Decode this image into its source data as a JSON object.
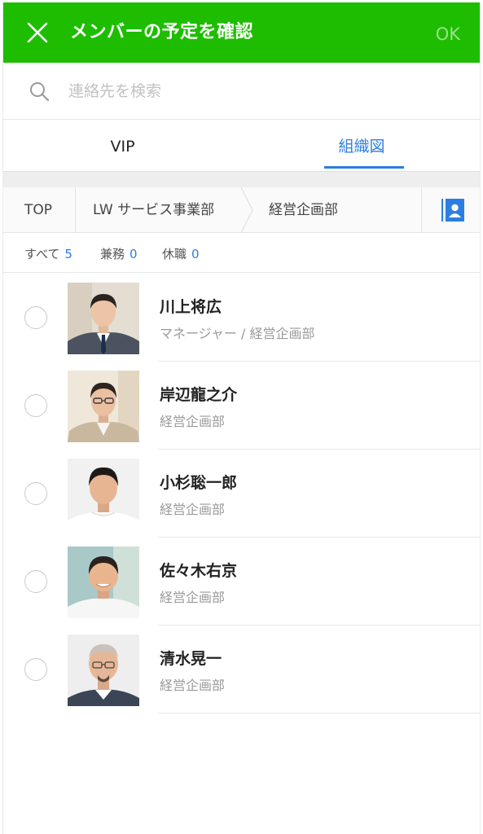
{
  "header": {
    "title": "メンバーの予定を確認",
    "ok_label": "OK",
    "bg_color": "#1ebd00"
  },
  "search": {
    "placeholder": "連絡先を検索"
  },
  "tabs": [
    {
      "label": "VIP",
      "active": false
    },
    {
      "label": "組織図",
      "active": true
    }
  ],
  "breadcrumb": {
    "items": [
      "TOP",
      "LW サービス事業部",
      "経営企画部"
    ]
  },
  "filters": [
    {
      "label": "すべて",
      "count": "5"
    },
    {
      "label": "兼務",
      "count": "0"
    },
    {
      "label": "休職",
      "count": "0"
    }
  ],
  "members": [
    {
      "name": "川上将広",
      "subtitle": "マネージャー / 経営企画部"
    },
    {
      "name": "岸辺龍之介",
      "subtitle": "経営企画部"
    },
    {
      "name": "小杉聡一郎",
      "subtitle": "経営企画部"
    },
    {
      "name": "佐々木右京",
      "subtitle": "経営企画部"
    },
    {
      "name": "清水晃一",
      "subtitle": "経営企画部"
    }
  ],
  "accent_color": "#2b7ee0"
}
